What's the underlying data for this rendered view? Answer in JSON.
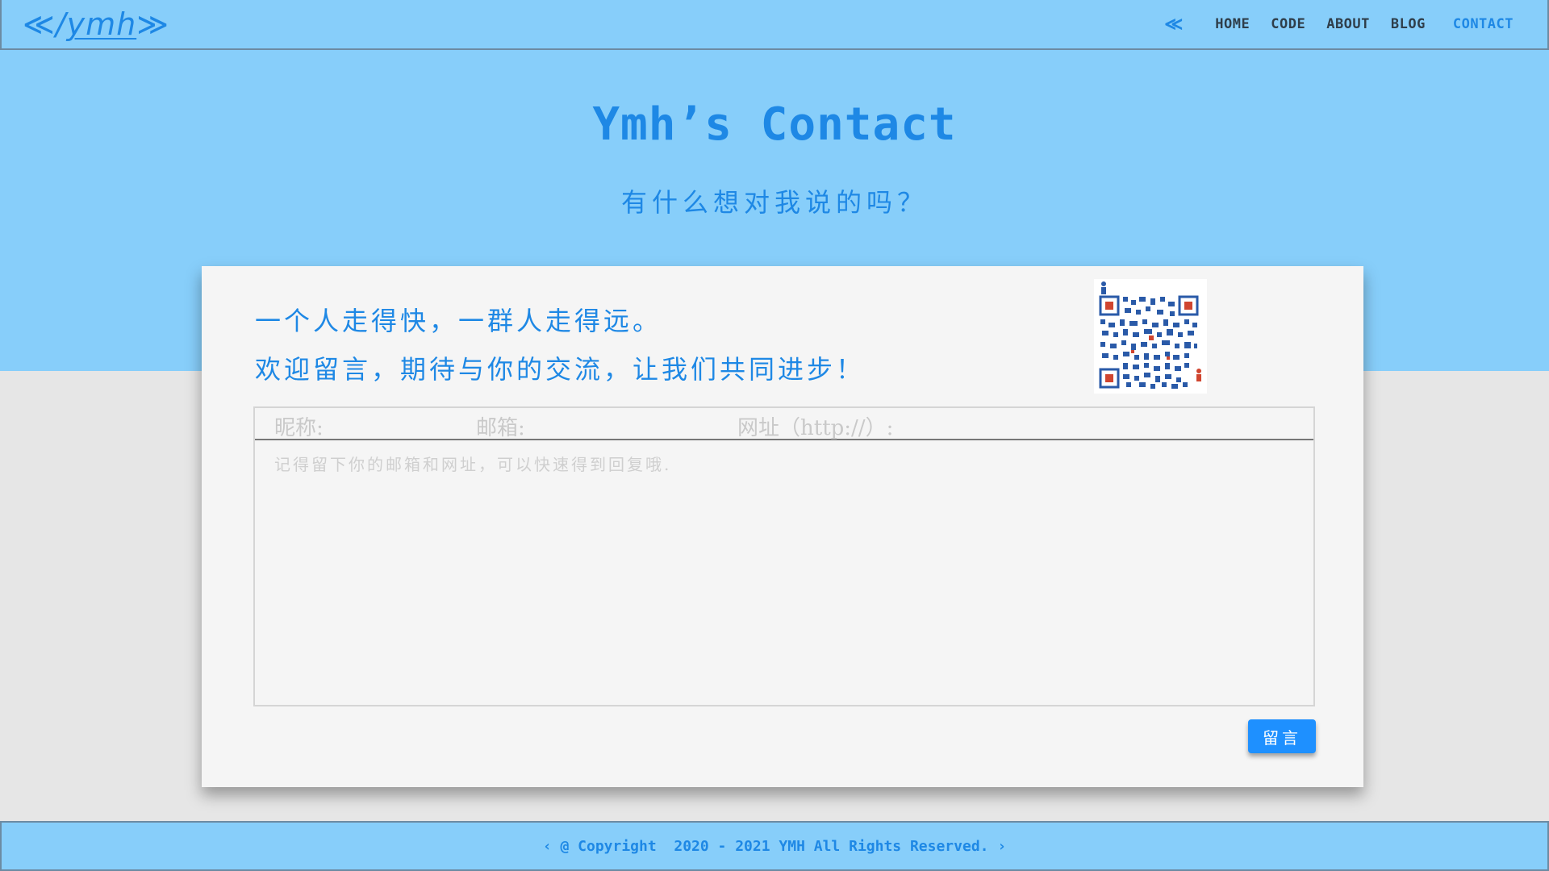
{
  "nav": {
    "logo_open": "≪/",
    "logo_text": "ymh",
    "logo_close": "≫",
    "chevron": "≪",
    "links": [
      "HOME",
      "CODE",
      "ABOUT",
      "BLOG",
      "CONTACT"
    ],
    "active": "CONTACT"
  },
  "header": {
    "title": "Ymh’s Contact",
    "subtitle": "有什么想对我说的吗？"
  },
  "card": {
    "quote_line1": "一个人走得快，一群人走得远。",
    "quote_line2": "欢迎留言，期待与你的交流，让我们共同进步！",
    "qr_icon": "qr-code"
  },
  "form": {
    "nickname_placeholder": "昵称:",
    "email_placeholder": "邮箱:",
    "url_placeholder": "网址（http://）:",
    "message_placeholder": "记得留下你的邮箱和网址，可以快速得到回复哦.",
    "submit_label": "留言"
  },
  "footer": {
    "text": "‹ @ Copyright  2020 - 2021 YMH All Rights Reserved. ›"
  },
  "colors": {
    "accent": "#1e88e5",
    "hero_bg": "#87cefa",
    "page_bg": "#e6e6e6",
    "button": "#1e90ff"
  }
}
